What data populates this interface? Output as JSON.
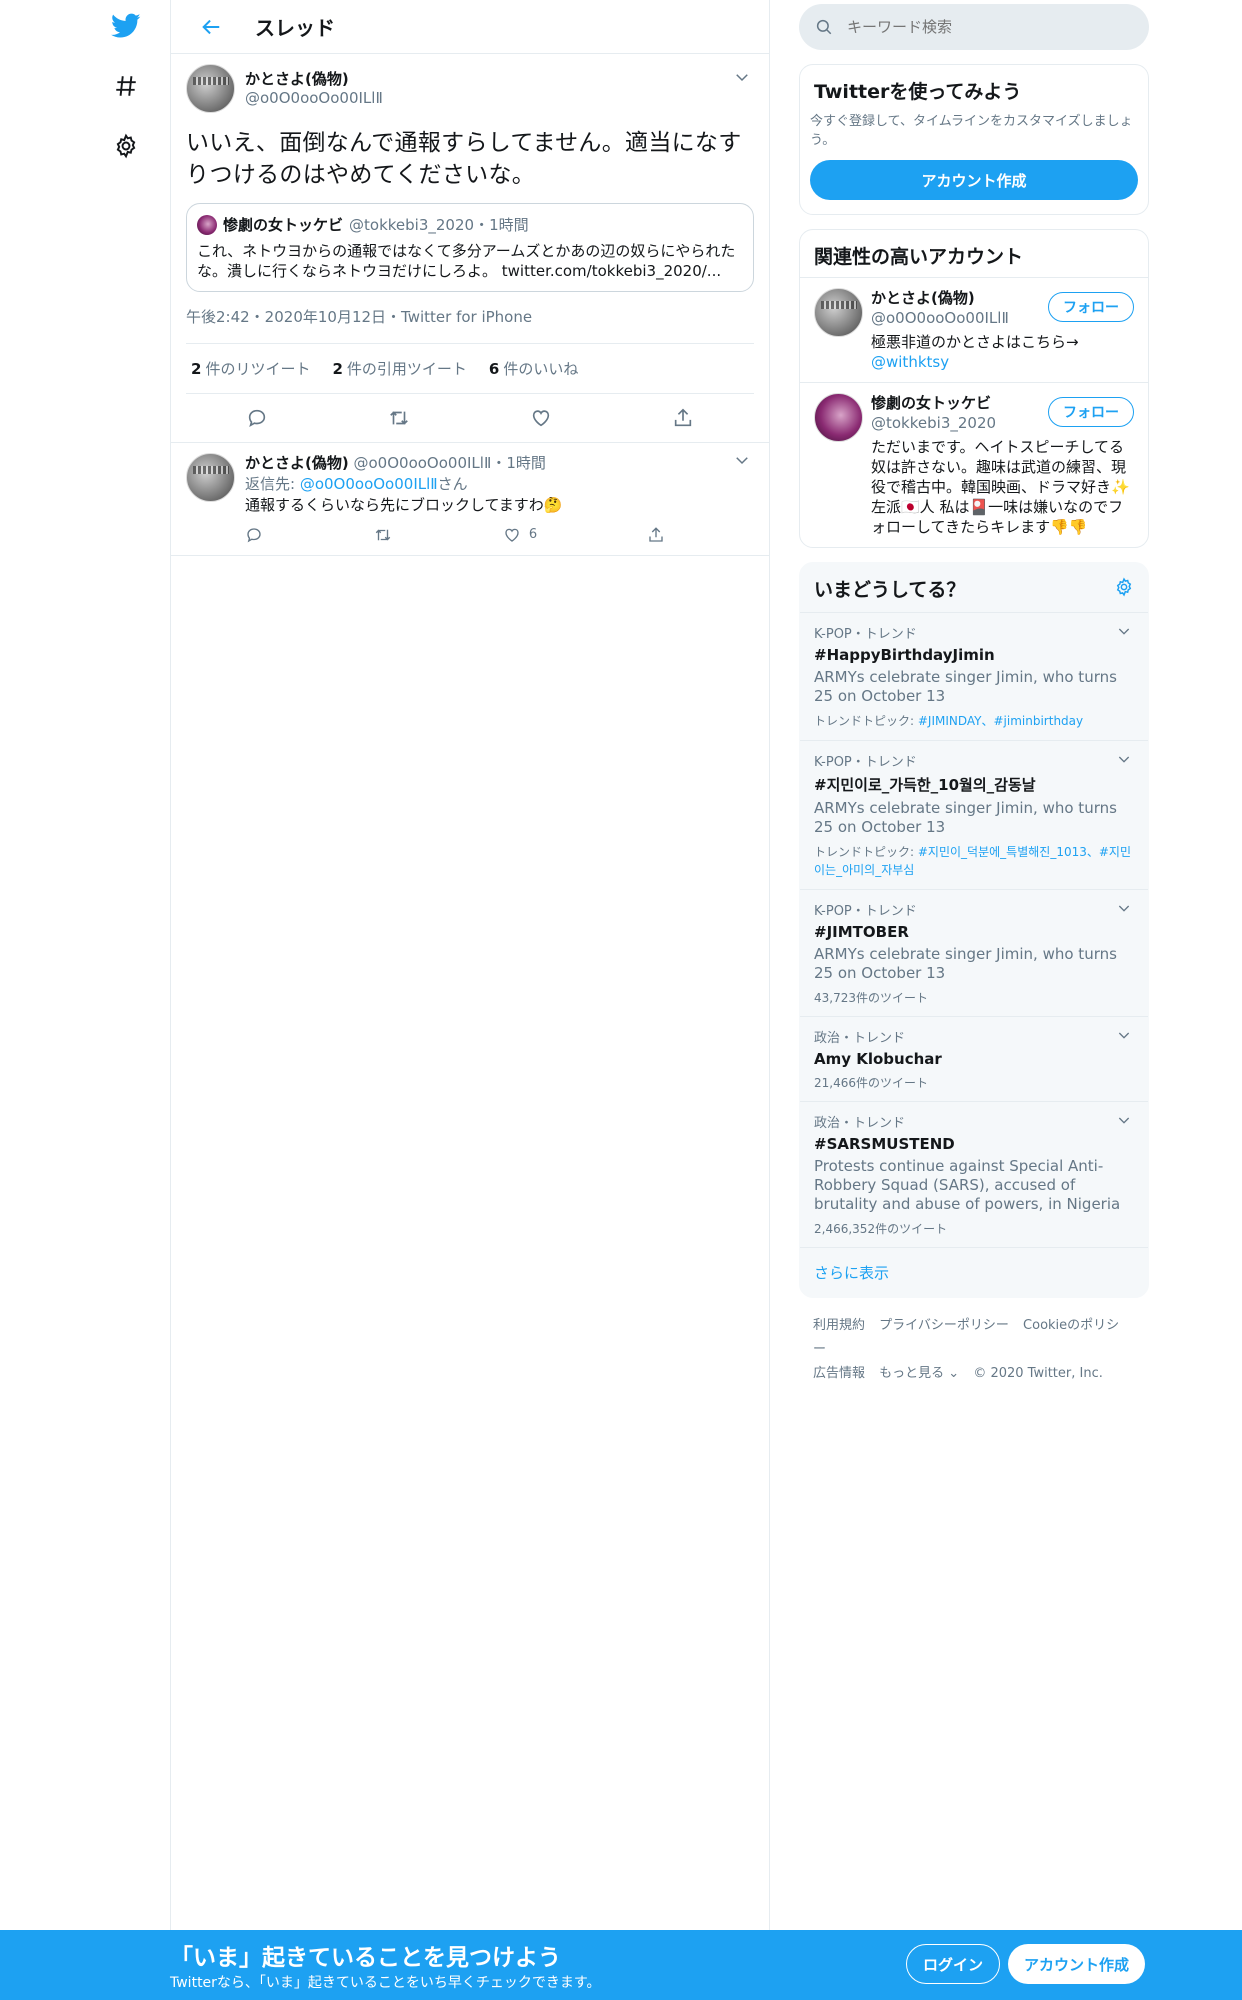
{
  "header": {
    "title": "スレッド"
  },
  "tweet": {
    "author_name": "かとさよ(偽物)",
    "author_handle": "@o0O0ooOo00ILlⅡ",
    "text": "いいえ、面倒なんで通報すらしてません。適当になすりつけるのはやめてくださいな。",
    "quote": {
      "name": "惨劇の女トッケビ",
      "handle": "@tokkebi3_2020",
      "time": "・1時間",
      "text": "これ、ネトウヨからの通報ではなくて多分アームズとかあの辺の奴らにやられたな。潰しに行くならネトウヨだけにしろよ。 twitter.com/tokkebi3_2020/..."
    },
    "timestamp": "午後2:42・2020年10月12日・Twitter for iPhone",
    "stats": [
      {
        "count": "2",
        "label": "件のリツイート"
      },
      {
        "count": "2",
        "label": "件の引用ツイート"
      },
      {
        "count": "6",
        "label": "件のいいね"
      }
    ]
  },
  "reply": {
    "author_name": "かとさよ(偽物)",
    "author_handle": "@o0O0ooOo00ILlⅡ",
    "time": "・1時間",
    "reply_to_prefix": "返信先: ",
    "reply_to_handle": "@o0O0ooOo00ILlⅡ",
    "reply_to_suffix": "さん",
    "text": "通報するくらいなら先にブロックしてますわ🤔",
    "like_count": "6"
  },
  "search": {
    "placeholder": "キーワード検索"
  },
  "signup_card": {
    "title": "Twitterを使ってみよう",
    "desc": "今すぐ登録して、タイムラインをカスタマイズしましょう。",
    "button": "アカウント作成"
  },
  "related": {
    "title": "関連性の高いアカウント",
    "follow_label": "フォロー",
    "accounts": [
      {
        "name": "かとさよ(偽物)",
        "handle": "@o0O0ooOo00ILlⅡ",
        "bio": "極悪非道のかとさよはこちら→",
        "bio_link": "@withktsy"
      },
      {
        "name": "惨劇の女トッケビ",
        "handle": "@tokkebi3_2020",
        "bio": "ただいまです。ヘイトスピーチしてる奴は許さない。趣味は武道の練習、現役で稽古中。韓国映画、ドラマ好き✨ 左派🇯🇵人 私は🎴一味は嫌いなのでフォローしてきたらキレます👎👎",
        "bio_link": ""
      }
    ]
  },
  "trends": {
    "title": "いまどうしてる？",
    "items": [
      {
        "context": "K-POP・トレンド",
        "name": "#HappyBirthdayJimin",
        "desc": "ARMYs celebrate singer Jimin, who turns 25 on October 13",
        "topics_label": "トレンドトピック: ",
        "topics": "#JIMINDAY、#jiminbirthday",
        "count": ""
      },
      {
        "context": "K-POP・トレンド",
        "name": "#지민이로_가득한_10월의_감동날",
        "desc": "ARMYs celebrate singer Jimin, who turns 25 on October 13",
        "topics_label": "トレンドトピック: ",
        "topics": "#지민이_덕분에_특별해진_1013、#지민이는_아미의_자부심",
        "count": ""
      },
      {
        "context": "K-POP・トレンド",
        "name": "#JIMTOBER",
        "desc": "ARMYs celebrate singer Jimin, who turns 25 on October 13",
        "topics_label": "",
        "topics": "",
        "count": "43,723件のツイート"
      },
      {
        "context": "政治・トレンド",
        "name": "Amy Klobuchar",
        "desc": "",
        "topics_label": "",
        "topics": "",
        "count": "21,466件のツイート"
      },
      {
        "context": "政治・トレンド",
        "name": "#SARSMUSTEND",
        "desc": "Protests continue against Special Anti-Robbery Squad (SARS), accused of brutality and abuse of powers, in Nigeria",
        "topics_label": "",
        "topics": "",
        "count": "2,466,352件のツイート"
      }
    ],
    "show_more": "さらに表示"
  },
  "footer": {
    "links": [
      "利用規約",
      "プライバシーポリシー",
      "Cookieのポリシー",
      "広告情報",
      "もっと見る ⌄"
    ],
    "copyright": "© 2020 Twitter, Inc."
  },
  "banner": {
    "title": "「いま」起きていることを見つけよう",
    "subtitle": "Twitterなら、「いま」起きていることをいち早くチェックできます。",
    "login": "ログイン",
    "signup": "アカウント作成"
  },
  "colors": {
    "brand": "#1da1f2",
    "muted": "#657786",
    "border": "#e6ecf0"
  },
  "icons": [
    "twitter-logo-icon",
    "hashtag-icon",
    "gear-icon",
    "back-arrow-icon",
    "chevron-down-icon",
    "reply-icon",
    "retweet-icon",
    "like-icon",
    "share-icon",
    "search-icon"
  ]
}
